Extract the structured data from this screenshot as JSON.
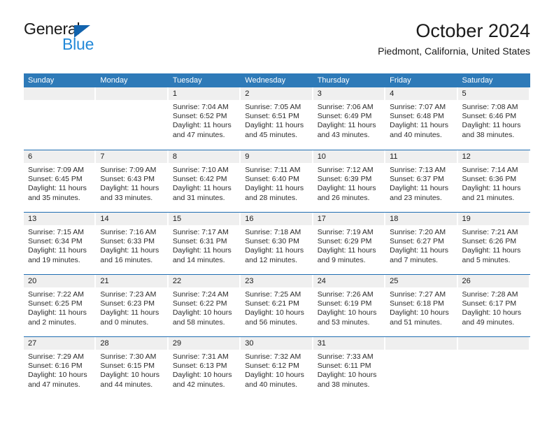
{
  "brand": {
    "word_one": "General",
    "word_two": "Blue",
    "triangle_icon": "triangle-logo-icon",
    "accent_dark": "#1263ad",
    "accent_light": "#2389d8"
  },
  "header": {
    "title": "October 2024",
    "subtitle": "Piedmont, California, United States"
  },
  "theme": {
    "header_blue": "#2e7ab8",
    "separator_blue": "#1f6db2",
    "day_band_gray": "#efefef"
  },
  "weekdays": [
    "Sunday",
    "Monday",
    "Tuesday",
    "Wednesday",
    "Thursday",
    "Friday",
    "Saturday"
  ],
  "weeks": [
    [
      {
        "day": "",
        "lines": []
      },
      {
        "day": "",
        "lines": []
      },
      {
        "day": "1",
        "lines": [
          "Sunrise: 7:04 AM",
          "Sunset: 6:52 PM",
          "Daylight: 11 hours",
          "and 47 minutes."
        ]
      },
      {
        "day": "2",
        "lines": [
          "Sunrise: 7:05 AM",
          "Sunset: 6:51 PM",
          "Daylight: 11 hours",
          "and 45 minutes."
        ]
      },
      {
        "day": "3",
        "lines": [
          "Sunrise: 7:06 AM",
          "Sunset: 6:49 PM",
          "Daylight: 11 hours",
          "and 43 minutes."
        ]
      },
      {
        "day": "4",
        "lines": [
          "Sunrise: 7:07 AM",
          "Sunset: 6:48 PM",
          "Daylight: 11 hours",
          "and 40 minutes."
        ]
      },
      {
        "day": "5",
        "lines": [
          "Sunrise: 7:08 AM",
          "Sunset: 6:46 PM",
          "Daylight: 11 hours",
          "and 38 minutes."
        ]
      }
    ],
    [
      {
        "day": "6",
        "lines": [
          "Sunrise: 7:09 AM",
          "Sunset: 6:45 PM",
          "Daylight: 11 hours",
          "and 35 minutes."
        ]
      },
      {
        "day": "7",
        "lines": [
          "Sunrise: 7:09 AM",
          "Sunset: 6:43 PM",
          "Daylight: 11 hours",
          "and 33 minutes."
        ]
      },
      {
        "day": "8",
        "lines": [
          "Sunrise: 7:10 AM",
          "Sunset: 6:42 PM",
          "Daylight: 11 hours",
          "and 31 minutes."
        ]
      },
      {
        "day": "9",
        "lines": [
          "Sunrise: 7:11 AM",
          "Sunset: 6:40 PM",
          "Daylight: 11 hours",
          "and 28 minutes."
        ]
      },
      {
        "day": "10",
        "lines": [
          "Sunrise: 7:12 AM",
          "Sunset: 6:39 PM",
          "Daylight: 11 hours",
          "and 26 minutes."
        ]
      },
      {
        "day": "11",
        "lines": [
          "Sunrise: 7:13 AM",
          "Sunset: 6:37 PM",
          "Daylight: 11 hours",
          "and 23 minutes."
        ]
      },
      {
        "day": "12",
        "lines": [
          "Sunrise: 7:14 AM",
          "Sunset: 6:36 PM",
          "Daylight: 11 hours",
          "and 21 minutes."
        ]
      }
    ],
    [
      {
        "day": "13",
        "lines": [
          "Sunrise: 7:15 AM",
          "Sunset: 6:34 PM",
          "Daylight: 11 hours",
          "and 19 minutes."
        ]
      },
      {
        "day": "14",
        "lines": [
          "Sunrise: 7:16 AM",
          "Sunset: 6:33 PM",
          "Daylight: 11 hours",
          "and 16 minutes."
        ]
      },
      {
        "day": "15",
        "lines": [
          "Sunrise: 7:17 AM",
          "Sunset: 6:31 PM",
          "Daylight: 11 hours",
          "and 14 minutes."
        ]
      },
      {
        "day": "16",
        "lines": [
          "Sunrise: 7:18 AM",
          "Sunset: 6:30 PM",
          "Daylight: 11 hours",
          "and 12 minutes."
        ]
      },
      {
        "day": "17",
        "lines": [
          "Sunrise: 7:19 AM",
          "Sunset: 6:29 PM",
          "Daylight: 11 hours",
          "and 9 minutes."
        ]
      },
      {
        "day": "18",
        "lines": [
          "Sunrise: 7:20 AM",
          "Sunset: 6:27 PM",
          "Daylight: 11 hours",
          "and 7 minutes."
        ]
      },
      {
        "day": "19",
        "lines": [
          "Sunrise: 7:21 AM",
          "Sunset: 6:26 PM",
          "Daylight: 11 hours",
          "and 5 minutes."
        ]
      }
    ],
    [
      {
        "day": "20",
        "lines": [
          "Sunrise: 7:22 AM",
          "Sunset: 6:25 PM",
          "Daylight: 11 hours",
          "and 2 minutes."
        ]
      },
      {
        "day": "21",
        "lines": [
          "Sunrise: 7:23 AM",
          "Sunset: 6:23 PM",
          "Daylight: 11 hours",
          "and 0 minutes."
        ]
      },
      {
        "day": "22",
        "lines": [
          "Sunrise: 7:24 AM",
          "Sunset: 6:22 PM",
          "Daylight: 10 hours",
          "and 58 minutes."
        ]
      },
      {
        "day": "23",
        "lines": [
          "Sunrise: 7:25 AM",
          "Sunset: 6:21 PM",
          "Daylight: 10 hours",
          "and 56 minutes."
        ]
      },
      {
        "day": "24",
        "lines": [
          "Sunrise: 7:26 AM",
          "Sunset: 6:19 PM",
          "Daylight: 10 hours",
          "and 53 minutes."
        ]
      },
      {
        "day": "25",
        "lines": [
          "Sunrise: 7:27 AM",
          "Sunset: 6:18 PM",
          "Daylight: 10 hours",
          "and 51 minutes."
        ]
      },
      {
        "day": "26",
        "lines": [
          "Sunrise: 7:28 AM",
          "Sunset: 6:17 PM",
          "Daylight: 10 hours",
          "and 49 minutes."
        ]
      }
    ],
    [
      {
        "day": "27",
        "lines": [
          "Sunrise: 7:29 AM",
          "Sunset: 6:16 PM",
          "Daylight: 10 hours",
          "and 47 minutes."
        ]
      },
      {
        "day": "28",
        "lines": [
          "Sunrise: 7:30 AM",
          "Sunset: 6:15 PM",
          "Daylight: 10 hours",
          "and 44 minutes."
        ]
      },
      {
        "day": "29",
        "lines": [
          "Sunrise: 7:31 AM",
          "Sunset: 6:13 PM",
          "Daylight: 10 hours",
          "and 42 minutes."
        ]
      },
      {
        "day": "30",
        "lines": [
          "Sunrise: 7:32 AM",
          "Sunset: 6:12 PM",
          "Daylight: 10 hours",
          "and 40 minutes."
        ]
      },
      {
        "day": "31",
        "lines": [
          "Sunrise: 7:33 AM",
          "Sunset: 6:11 PM",
          "Daylight: 10 hours",
          "and 38 minutes."
        ]
      },
      {
        "day": "",
        "lines": []
      },
      {
        "day": "",
        "lines": []
      }
    ]
  ]
}
